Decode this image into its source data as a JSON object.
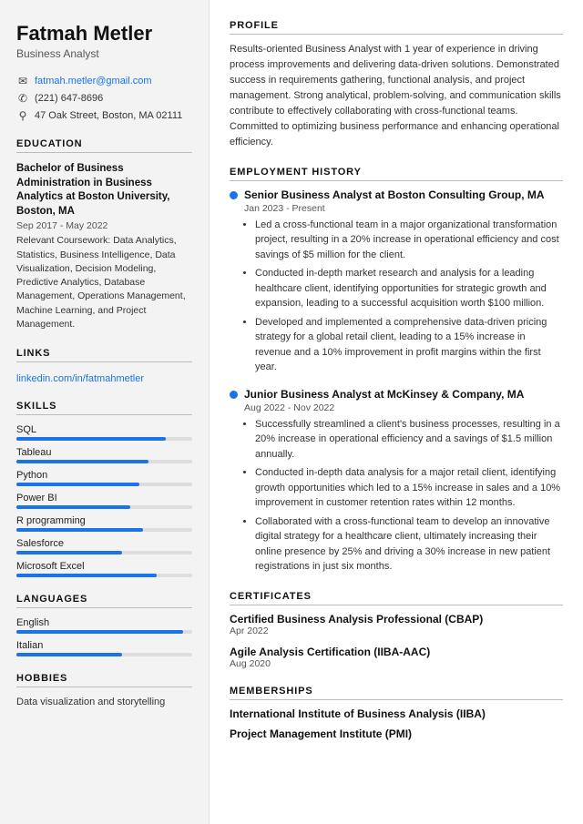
{
  "sidebar": {
    "name": "Fatmah Metler",
    "title": "Business Analyst",
    "contact": {
      "email": "fatmah.metler@gmail.com",
      "phone": "(221) 647-8696",
      "address": "47 Oak Street, Boston, MA 02111"
    },
    "education": {
      "section_label": "Education",
      "degree": "Bachelor of Business Administration in Business Analytics at Boston University, Boston, MA",
      "dates": "Sep 2017 - May 2022",
      "coursework_label": "Relevant Coursework:",
      "coursework": "Data Analytics, Statistics, Business Intelligence, Data Visualization, Decision Modeling, Predictive Analytics, Database Management, Operations Management, Machine Learning, and Project Management."
    },
    "links": {
      "section_label": "Links",
      "linkedin": "linkedin.com/in/fatmahmetler"
    },
    "skills": {
      "section_label": "Skills",
      "items": [
        {
          "label": "SQL",
          "pct": 85
        },
        {
          "label": "Tableau",
          "pct": 75
        },
        {
          "label": "Python",
          "pct": 70
        },
        {
          "label": "Power BI",
          "pct": 65
        },
        {
          "label": "R programming",
          "pct": 72
        },
        {
          "label": "Salesforce",
          "pct": 60
        },
        {
          "label": "Microsoft Excel",
          "pct": 80
        }
      ]
    },
    "languages": {
      "section_label": "Languages",
      "items": [
        {
          "label": "English",
          "pct": 95
        },
        {
          "label": "Italian",
          "pct": 60
        }
      ]
    },
    "hobbies": {
      "section_label": "Hobbies",
      "text": "Data visualization and storytelling"
    }
  },
  "main": {
    "profile": {
      "section_label": "Profile",
      "text": "Results-oriented Business Analyst with 1 year of experience in driving process improvements and delivering data-driven solutions. Demonstrated success in requirements gathering, functional analysis, and project management. Strong analytical, problem-solving, and communication skills contribute to effectively collaborating with cross-functional teams. Committed to optimizing business performance and enhancing operational efficiency."
    },
    "employment": {
      "section_label": "Employment History",
      "jobs": [
        {
          "title": "Senior Business Analyst at Boston Consulting Group, MA",
          "dates": "Jan 2023 - Present",
          "bullets": [
            "Led a cross-functional team in a major organizational transformation project, resulting in a 20% increase in operational efficiency and cost savings of $5 million for the client.",
            "Conducted in-depth market research and analysis for a leading healthcare client, identifying opportunities for strategic growth and expansion, leading to a successful acquisition worth $100 million.",
            "Developed and implemented a comprehensive data-driven pricing strategy for a global retail client, leading to a 15% increase in revenue and a 10% improvement in profit margins within the first year."
          ]
        },
        {
          "title": "Junior Business Analyst at McKinsey & Company, MA",
          "dates": "Aug 2022 - Nov 2022",
          "bullets": [
            "Successfully streamlined a client's business processes, resulting in a 20% increase in operational efficiency and a savings of $1.5 million annually.",
            "Conducted in-depth data analysis for a major retail client, identifying growth opportunities which led to a 15% increase in sales and a 10% improvement in customer retention rates within 12 months.",
            "Collaborated with a cross-functional team to develop an innovative digital strategy for a healthcare client, ultimately increasing their online presence by 25% and driving a 30% increase in new patient registrations in just six months."
          ]
        }
      ]
    },
    "certificates": {
      "section_label": "Certificates",
      "items": [
        {
          "name": "Certified Business Analysis Professional (CBAP)",
          "date": "Apr 2022"
        },
        {
          "name": "Agile Analysis Certification (IIBA-AAC)",
          "date": "Aug 2020"
        }
      ]
    },
    "memberships": {
      "section_label": "Memberships",
      "items": [
        "International Institute of Business Analysis (IIBA)",
        "Project Management Institute (PMI)"
      ]
    }
  }
}
